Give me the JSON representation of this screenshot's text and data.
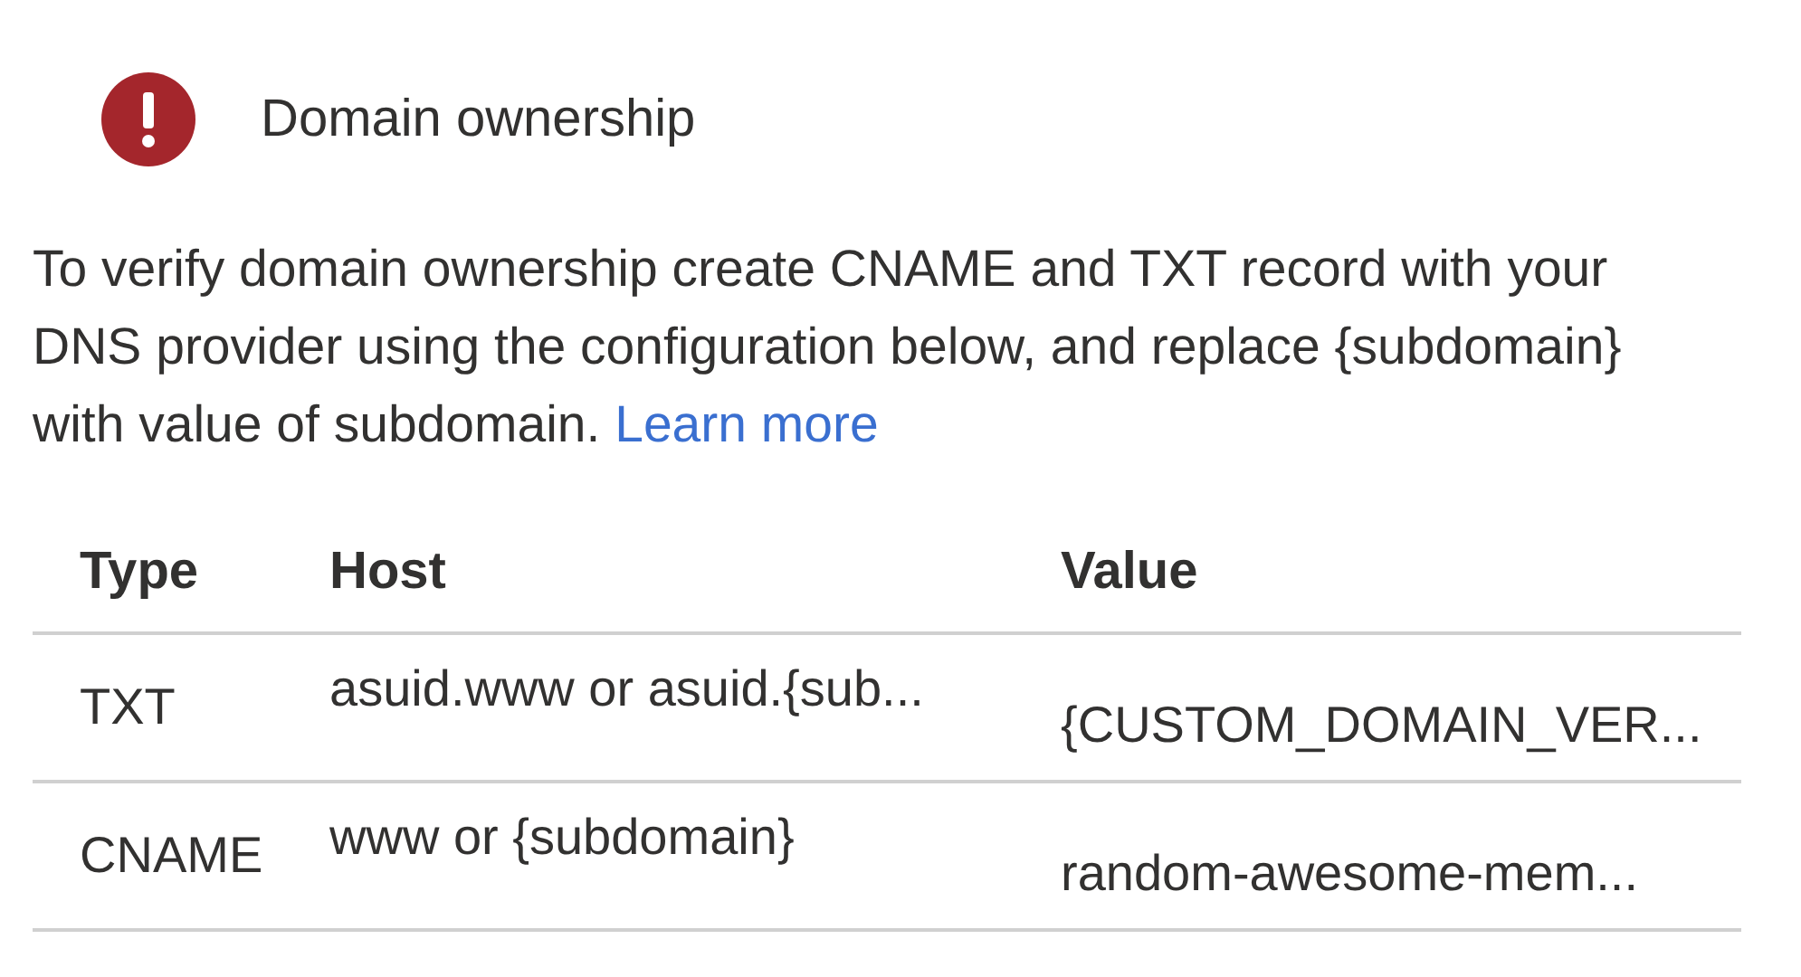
{
  "header": {
    "title": "Domain ownership"
  },
  "description": {
    "text": "To verify domain ownership create CNAME and TXT record with your DNS provider using the configuration below, and replace {subdomain} with value of subdomain.",
    "link": "Learn more"
  },
  "table": {
    "columns": [
      "Type",
      "Host",
      "Value"
    ],
    "rows": [
      {
        "type": "TXT",
        "host": "asuid.www or asuid.{sub...",
        "value": "{CUSTOM_DOMAIN_VER..."
      },
      {
        "type": "CNAME",
        "host": "www or {subdomain}",
        "value": "random-awesome-mem..."
      }
    ]
  }
}
